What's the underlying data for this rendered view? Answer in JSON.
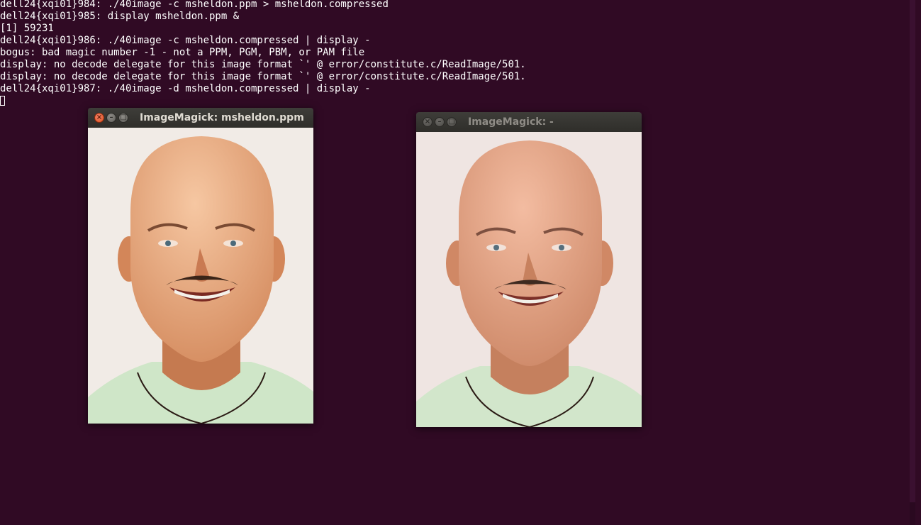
{
  "terminal": {
    "lines": [
      "dell24{xqi01}984: ./40image -c msheldon.ppm > msheldon.compressed",
      "dell24{xqi01}985: display msheldon.ppm &",
      "[1] 59231",
      "dell24{xqi01}986: ./40image -c msheldon.compressed | display -",
      "bogus: bad magic number -1 - not a PPM, PGM, PBM, or PAM file",
      "display: no decode delegate for this image format `' @ error/constitute.c/ReadImage/501.",
      "display: no decode delegate for this image format `' @ error/constitute.c/ReadImage/501.",
      "dell24{xqi01}987: ./40image -d msheldon.compressed | display -"
    ]
  },
  "windows": [
    {
      "title": "ImageMagick: msheldon.ppm",
      "state": "active",
      "image": "smiling-bald-man-portrait"
    },
    {
      "title": "ImageMagick: -",
      "state": "inactive",
      "image": "smiling-bald-man-portrait-decompressed"
    }
  ],
  "colors": {
    "terminal_bg": "#300a24",
    "terminal_fg": "#ffffff",
    "close_button": "#e0531f",
    "titlebar": "#3c3b37"
  }
}
